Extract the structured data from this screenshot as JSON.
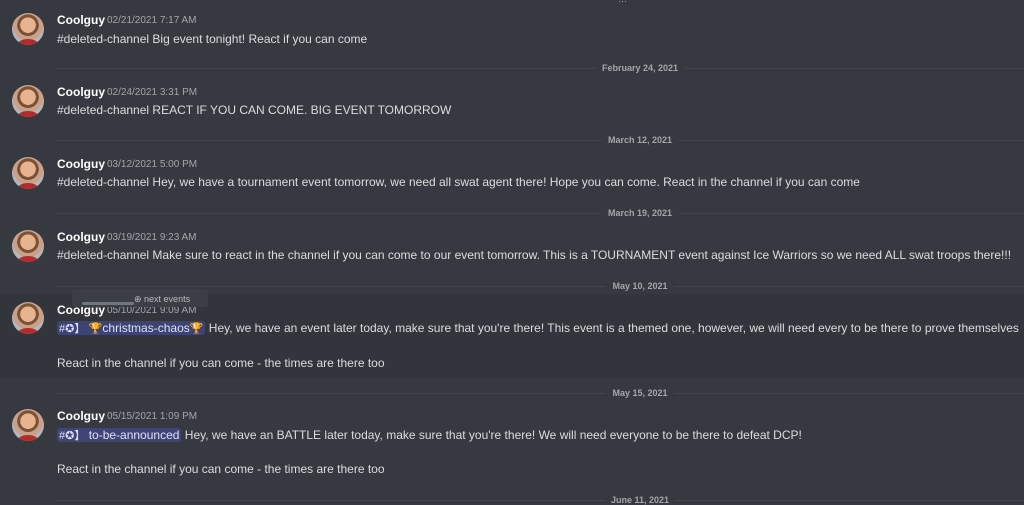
{
  "top_fragment": "…",
  "messages": [
    {
      "author": "Coolguy",
      "timestamp": "02/21/2021 7:17 AM",
      "text": "#deleted-channel Big event tonight! React if you can come"
    },
    {
      "author": "Coolguy",
      "timestamp": "02/24/2021 3:31 PM",
      "text": "#deleted-channel REACT IF YOU CAN COME. BIG EVENT TOMORROW"
    },
    {
      "author": "Coolguy",
      "timestamp": "03/12/2021 5:00 PM",
      "text": "#deleted-channel Hey, we have a tournament event tomorrow, we need all swat agent there! Hope you can come. React in the channel if you can come"
    },
    {
      "author": "Coolguy",
      "timestamp": "03/19/2021 9:23 AM",
      "text": "#deleted-channel Make sure to react in the channel if you can come to our event tomorrow. This is a TOURNAMENT event against Ice Warriors so we need ALL swat troops there!!!"
    },
    {
      "author": "Coolguy",
      "timestamp": "05/10/2021 9:09 AM",
      "mention_icon": "#✪】",
      "mention": "christmas-chaos",
      "text": "Hey, we have an event later today, make sure that you're there! This event is a themed one, however, we will need every to be there to prove themselves",
      "text2": "React in the channel if you can come - the times are there too"
    },
    {
      "author": "Coolguy",
      "timestamp": "05/15/2021 1:09 PM",
      "mention_icon": "#✪】",
      "mention": "to-be-announced",
      "text": "Hey, we have an BATTLE later today, make sure that you're there! We will need everyone to be there to defeat DCP!",
      "text2": "React in the channel if you can come - the times are there too"
    }
  ],
  "dividers": [
    "February 24, 2021",
    "March 12, 2021",
    "March 19, 2021",
    "May 10, 2021",
    "May 15, 2021",
    "June 11, 2021"
  ],
  "tooltip": {
    "label": "⊕ next events"
  }
}
